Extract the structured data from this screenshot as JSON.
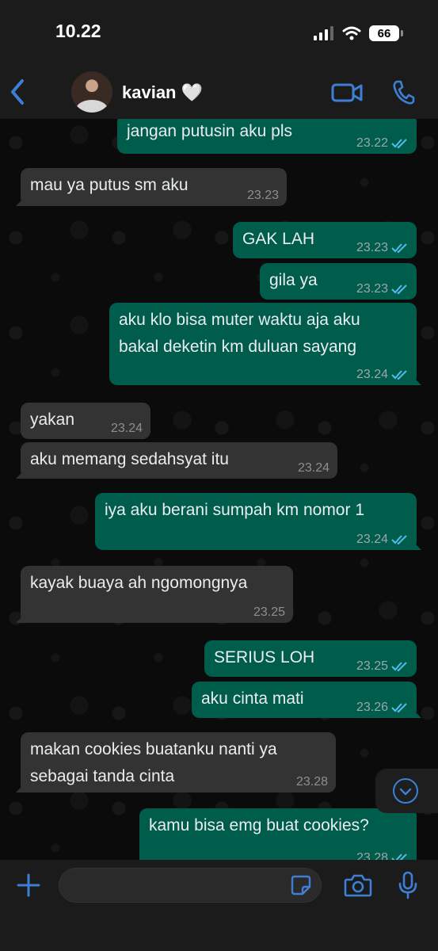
{
  "status_bar": {
    "time": "10.22",
    "battery": "66"
  },
  "header": {
    "contact_name": "kavian 🤍"
  },
  "messages": [
    {
      "dir": "out",
      "text": "jangan putusin aku pls",
      "time": "23.22",
      "read": true
    },
    {
      "dir": "in",
      "text": "mau ya putus sm aku",
      "time": "23.23"
    },
    {
      "dir": "out",
      "text": "GAK LAH",
      "time": "23.23",
      "read": true
    },
    {
      "dir": "out",
      "text": "gila ya",
      "time": "23.23",
      "read": true
    },
    {
      "dir": "out",
      "text": "aku klo bisa muter waktu aja aku\nbakal deketin km duluan sayang",
      "time": "23.24",
      "read": true
    },
    {
      "dir": "in",
      "text": "yakan",
      "time": "23.24"
    },
    {
      "dir": "in",
      "text": "aku memang sedahsyat itu",
      "time": "23.24"
    },
    {
      "dir": "out",
      "text": "iya aku berani sumpah km nomor 1",
      "time": "23.24",
      "read": true
    },
    {
      "dir": "in",
      "text": "kayak buaya ah ngomongnya",
      "time": "23.25"
    },
    {
      "dir": "out",
      "text": "SERIUS LOH",
      "time": "23.25",
      "read": true
    },
    {
      "dir": "out",
      "text": "aku cinta mati",
      "time": "23.26",
      "read": true
    },
    {
      "dir": "in",
      "text": "makan cookies buatanku nanti ya\nsebagai tanda cinta",
      "time": "23.28"
    },
    {
      "dir": "out",
      "text": "kamu bisa emg buat cookies?",
      "time": "23.28",
      "read": true
    }
  ],
  "input": {
    "placeholder": ""
  },
  "colors": {
    "accent": "#3e7fd6",
    "outgoing": "#005c4b",
    "incoming": "#333333",
    "read_ticks": "#53bdeb"
  }
}
